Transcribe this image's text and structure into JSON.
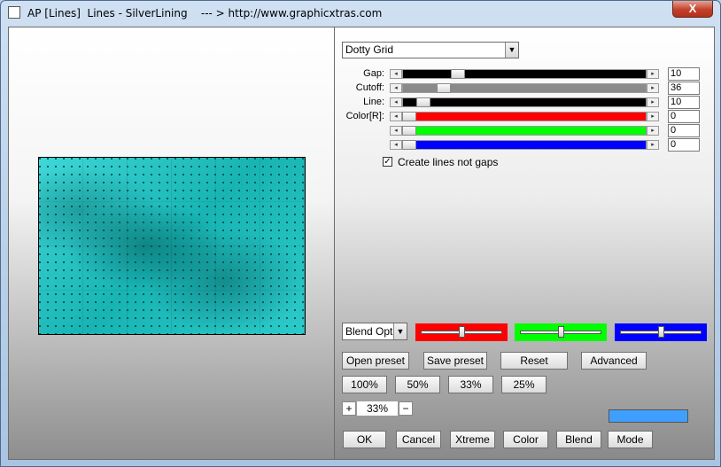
{
  "window": {
    "title": "AP [Lines]  Lines - SilverLining    --- > http://www.graphicxtras.com",
    "close_label": "X"
  },
  "preset_dropdown": {
    "value": "Dotty Grid"
  },
  "sliders": [
    {
      "label": "Gap:",
      "value": "10",
      "track_color": "#000000",
      "level": 0.21
    },
    {
      "label": "Cutoff:",
      "value": "36",
      "track_color": "#8a8a8a",
      "level": 0.15
    },
    {
      "label": "Line:",
      "value": "10",
      "track_color": "#000000",
      "level": 0.06
    },
    {
      "label": "Color[R]:",
      "value": "0",
      "track_color": "#ff0000",
      "level": 0.0
    },
    {
      "label": "",
      "value": "0",
      "track_color": "#00ff00",
      "level": 0.0
    },
    {
      "label": "",
      "value": "0",
      "track_color": "#0000ff",
      "level": 0.0
    }
  ],
  "checkbox": {
    "label": "Create lines not gaps",
    "checked": true,
    "mark": "✓"
  },
  "blend_dropdown": {
    "value": "Blend Opti"
  },
  "color_panels": [
    {
      "color": "#ff0000",
      "level": 0.5
    },
    {
      "color": "#00ff00",
      "level": 0.5
    },
    {
      "color": "#0000ff",
      "level": 0.5
    }
  ],
  "preset_buttons": {
    "open": "Open preset",
    "save": "Save preset",
    "reset": "Reset",
    "advanced": "Advanced"
  },
  "zoom_buttons": [
    "100%",
    "50%",
    "33%",
    "25%"
  ],
  "zoom_stepper": {
    "plus": "+",
    "value": "33%",
    "minus": "−"
  },
  "swatch_color": "#3f9fff",
  "bottom_buttons": {
    "ok": "OK",
    "cancel": "Cancel",
    "xtreme": "Xtreme",
    "color": "Color",
    "blend": "Blend",
    "mode": "Mode"
  }
}
